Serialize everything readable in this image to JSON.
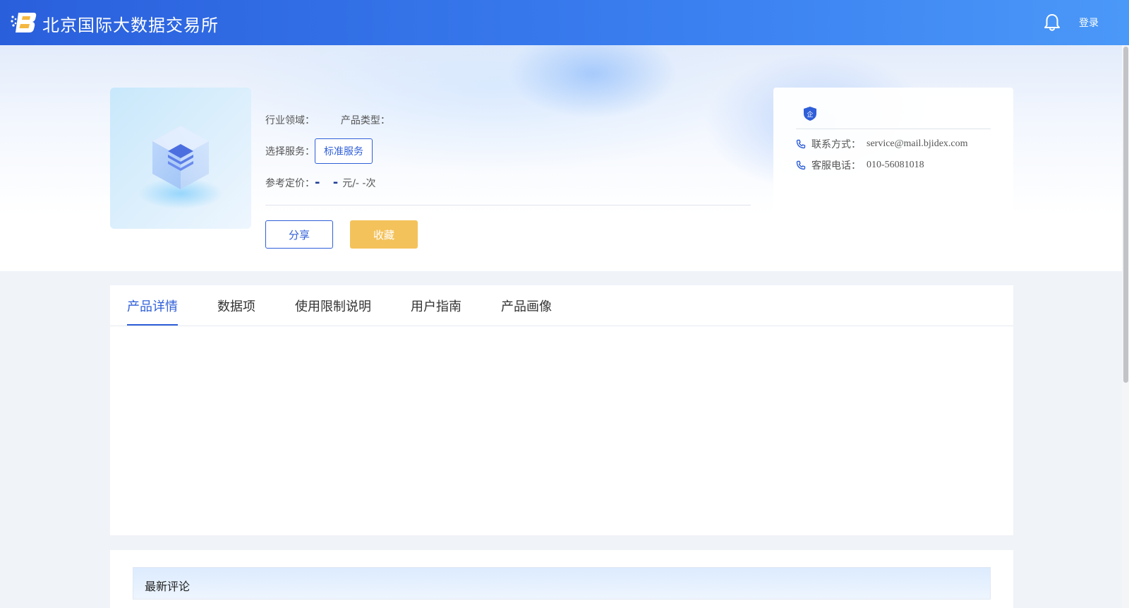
{
  "header": {
    "brand": "北京国际大数据交易所",
    "login_label": "登录",
    "icons": {
      "logo": "bjidex-logo",
      "notification": "bell-icon"
    }
  },
  "product": {
    "industry_label": "行业领域：",
    "industry_value": "",
    "type_label": "产品类型：",
    "type_value": "",
    "service_label": "选择服务：",
    "service_option": "标准服务",
    "price_label": "参考定价：",
    "price_value": "- -",
    "price_unit": "元/- -次",
    "share_label": "分享",
    "collect_label": "收藏",
    "image_icon": "data-layers-cube-icon"
  },
  "contact": {
    "badge_icon": "enterprise-shield-icon",
    "badge_text": "企",
    "rows": [
      {
        "label": "联系方式：",
        "value": "service@mail.bjidex.com",
        "icon": "phone-icon"
      },
      {
        "label": "客服电话：",
        "value": "010-56081018",
        "icon": "phone-icon"
      }
    ]
  },
  "tabs": {
    "active_index": 0,
    "items": [
      "产品详情",
      "数据项",
      "使用限制说明",
      "用户指南",
      "产品画像"
    ]
  },
  "comments": {
    "title": "最新评论"
  },
  "colors": {
    "primary": "#2f5fd8",
    "header_start": "#2a5fdc",
    "header_end": "#4a98f8",
    "collect_button": "#f4c25a",
    "page_background": "#f0f3f8"
  }
}
